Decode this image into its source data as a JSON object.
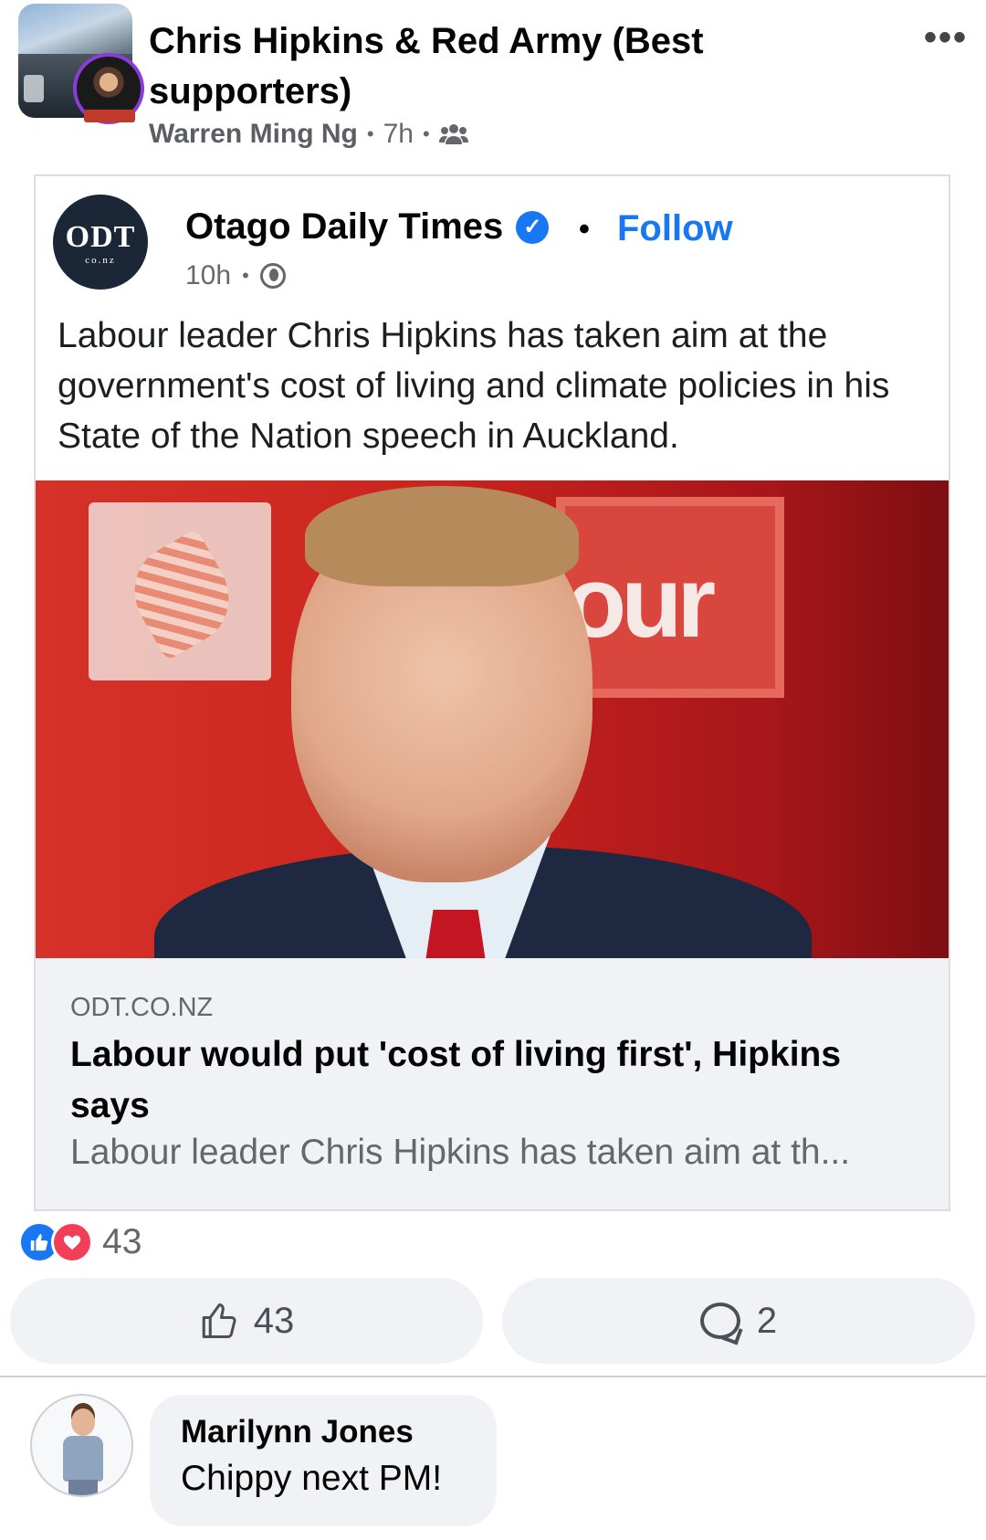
{
  "group": {
    "name": "Chris Hipkins & Red Army (Best supporters)",
    "author": "Warren Ming Ng",
    "time": "7h",
    "more_icon": "more-options-icon",
    "audience_icon": "group-members-icon"
  },
  "shared_post": {
    "page_logo_text": "ODT",
    "page_logo_sub": "co.nz",
    "page_name": "Otago Daily Times",
    "verified_icon": "verified-badge-icon",
    "follow_label": "Follow",
    "time": "10h",
    "privacy_icon": "globe-icon",
    "text": "Labour leader Chris Hipkins has taken aim at the government's cost of living and climate policies in his State of the Nation speech in Auckland.",
    "image_sign_text": "our",
    "link": {
      "domain": "ODT.CO.NZ",
      "title": "Labour would put 'cost of living first', Hipkins says",
      "description": "Labour leader Chris Hipkins has taken aim at th..."
    }
  },
  "reactions": {
    "count": "43",
    "types": [
      "like-reaction-icon",
      "love-reaction-icon"
    ]
  },
  "actions": {
    "like_count": "43",
    "comment_count": "2"
  },
  "comment": {
    "name": "Marilynn Jones",
    "text": "Chippy next PM!"
  },
  "colors": {
    "accent": "#1877f2",
    "love": "#f33e58",
    "secondary_text": "#65676b",
    "button_bg": "#f0f2f5"
  }
}
